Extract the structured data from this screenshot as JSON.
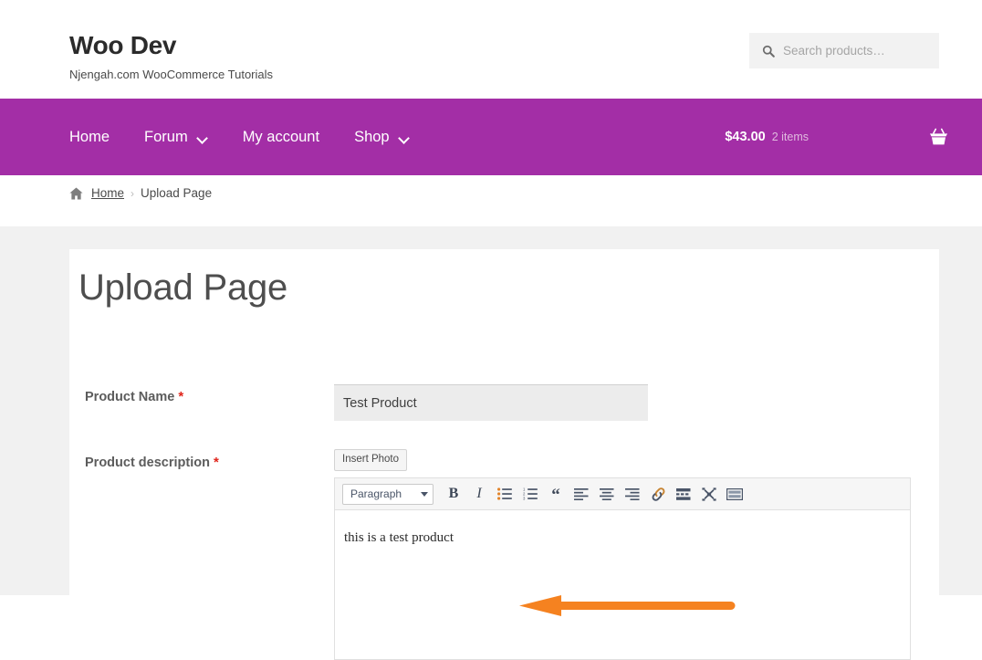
{
  "header": {
    "brand_title": "Woo Dev",
    "tagline": "Njengah.com WooCommerce Tutorials",
    "search": {
      "icon": "search-icon",
      "placeholder": "Search products…",
      "value": ""
    }
  },
  "nav": {
    "items": [
      {
        "label": "Home",
        "has_dropdown": false
      },
      {
        "label": "Forum",
        "has_dropdown": true
      },
      {
        "label": "My account",
        "has_dropdown": false
      },
      {
        "label": "Shop",
        "has_dropdown": true
      }
    ],
    "cart": {
      "amount": "$43.00",
      "count": "2 items",
      "icon": "shopping-basket-icon"
    },
    "background_color": "#a32ea6"
  },
  "breadcrumb": {
    "home_icon": "home-icon",
    "home_label": "Home",
    "separator": "›",
    "current": "Upload Page"
  },
  "page": {
    "title": "Upload Page",
    "background_color": "#f1f1f1",
    "card_color": "#ffffff"
  },
  "form": {
    "required_marker": "*",
    "fields": [
      {
        "label": "Product Name",
        "required": true,
        "value": "Test Product",
        "placeholder": ""
      },
      {
        "label": "Product description",
        "required": true,
        "value": "this is a test product"
      }
    ],
    "insert_photo_label": "Insert Photo",
    "editor": {
      "format_select": {
        "value": "Paragraph",
        "caret_icon": "chevron-down-icon"
      },
      "buttons": [
        {
          "name": "bold-button",
          "glyph": "B"
        },
        {
          "name": "italic-button",
          "glyph": "I"
        },
        {
          "name": "bulleted-list-button",
          "glyph": ""
        },
        {
          "name": "numbered-list-button",
          "glyph": ""
        },
        {
          "name": "blockquote-button",
          "glyph": "“"
        },
        {
          "name": "align-left-button",
          "glyph": ""
        },
        {
          "name": "align-center-button",
          "glyph": ""
        },
        {
          "name": "align-right-button",
          "glyph": ""
        },
        {
          "name": "insert-link-button",
          "glyph": ""
        },
        {
          "name": "insert-read-more-button",
          "glyph": ""
        },
        {
          "name": "fullscreen-button",
          "glyph": ""
        },
        {
          "name": "keyboard-shortcuts-button",
          "glyph": ""
        }
      ],
      "content": "this is a test product"
    }
  },
  "annotation": {
    "arrow_color": "#f58220",
    "direction": "left"
  }
}
